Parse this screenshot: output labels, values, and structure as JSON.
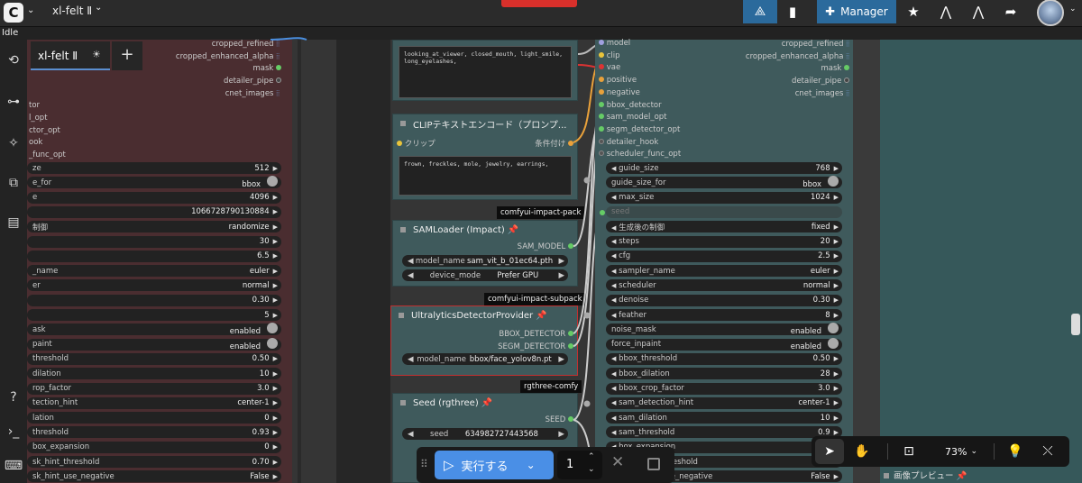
{
  "topbar": {
    "logo": "C",
    "workflow_name": "xl-felt Ⅱ",
    "manager_label": "Manager"
  },
  "status": "Idle",
  "tab": {
    "label": "xl-felt Ⅱ"
  },
  "left_node": {
    "outputs": [
      "cropped_refined",
      "cropped_enhanced_alpha",
      "mask",
      "detailer_pipe",
      "cnet_images"
    ],
    "inputs": [
      "tor",
      "l_opt",
      "ctor_opt",
      "ook",
      "_func_opt"
    ],
    "widgets": [
      {
        "label": "ze",
        "value": "512"
      },
      {
        "label": "e_for",
        "value": "bbox"
      },
      {
        "label": "e",
        "value": "4096"
      },
      {
        "label": "",
        "value": "1066728790130884"
      },
      {
        "label": "制御",
        "value": "randomize"
      },
      {
        "label": "",
        "value": "30"
      },
      {
        "label": "",
        "value": "6.5"
      },
      {
        "label": "_name",
        "value": "euler"
      },
      {
        "label": "er",
        "value": "normal"
      },
      {
        "label": "",
        "value": "0.30"
      },
      {
        "label": "",
        "value": "5"
      },
      {
        "label": "ask",
        "value": "enabled"
      },
      {
        "label": "paint",
        "value": "enabled"
      },
      {
        "label": "threshold",
        "value": "0.50"
      },
      {
        "label": "dilation",
        "value": "10"
      },
      {
        "label": "rop_factor",
        "value": "3.0"
      },
      {
        "label": "tection_hint",
        "value": "center-1"
      },
      {
        "label": "lation",
        "value": "0"
      },
      {
        "label": "threshold",
        "value": "0.93"
      },
      {
        "label": "box_expansion",
        "value": "0"
      },
      {
        "label": "sk_hint_threshold",
        "value": "0.70"
      },
      {
        "label": "sk_hint_use_negative",
        "value": "False"
      }
    ]
  },
  "mid": {
    "prompt1": "looking_at_viewer, closed_mouth, light_smile, long_eyelashes,",
    "clip_title": "CLIPテキストエンコード（プロンプ...",
    "clip_input": "クリップ",
    "clip_output": "条件付け",
    "prompt2": "frown, freckles, mole, jewelry, earrings,",
    "tag1": "comfyui-impact-pack",
    "samloader_title": "SAMLoader (Impact)",
    "sam_output": "SAM_MODEL",
    "model_name_label": "model_name",
    "model_name_value": "sam_vit_b_01ec64.pth",
    "device_mode_label": "device_mode",
    "device_mode_value": "Prefer GPU",
    "tag2": "comfyui-impact-subpack",
    "ultra_title": "UltralyticsDetectorProvider",
    "bbox_out": "BBOX_DETECTOR",
    "segm_out": "SEGM_DETECTOR",
    "ultra_model_label": "model_name",
    "ultra_model_value": "bbox/face_yolov8n.pt",
    "tag3": "rgthree-comfy",
    "seed_title": "Seed (rgthree)",
    "seed_out": "SEED",
    "seed_label": "seed",
    "seed_value": "634982727443568"
  },
  "right_node": {
    "inputs": [
      "model",
      "clip",
      "vae",
      "positive",
      "negative",
      "bbox_detector",
      "sam_model_opt",
      "segm_detector_opt",
      "detailer_hook",
      "scheduler_func_opt"
    ],
    "outputs": [
      "cropped_refined",
      "cropped_enhanced_alpha",
      "mask",
      "detailer_pipe",
      "cnet_images"
    ],
    "widgets": [
      {
        "label": "guide_size",
        "value": "768"
      },
      {
        "label": "guide_size_for",
        "value": "bbox"
      },
      {
        "label": "max_size",
        "value": "1024"
      },
      {
        "label": "seed",
        "value": ""
      },
      {
        "label": "生成後の制御",
        "value": "fixed"
      },
      {
        "label": "steps",
        "value": "20"
      },
      {
        "label": "cfg",
        "value": "2.5"
      },
      {
        "label": "sampler_name",
        "value": "euler"
      },
      {
        "label": "scheduler",
        "value": "normal"
      },
      {
        "label": "denoise",
        "value": "0.30"
      },
      {
        "label": "feather",
        "value": "8"
      },
      {
        "label": "noise_mask",
        "value": "enabled"
      },
      {
        "label": "force_inpaint",
        "value": "enabled"
      },
      {
        "label": "bbox_threshold",
        "value": "0.50"
      },
      {
        "label": "bbox_dilation",
        "value": "28"
      },
      {
        "label": "bbox_crop_factor",
        "value": "3.0"
      },
      {
        "label": "sam_detection_hint",
        "value": "center-1"
      },
      {
        "label": "sam_dilation",
        "value": "10"
      },
      {
        "label": "sam_threshold",
        "value": "0.9"
      },
      {
        "label": "box_expansion",
        "value": ""
      },
      {
        "label": "mask_hint_threshold",
        "value": "0."
      },
      {
        "label": "mask_hint_use_negative",
        "value": "False"
      }
    ]
  },
  "far_right": {
    "preview_title": "画像プレビュー"
  },
  "runbar": {
    "run_label": "実行する",
    "count": "1"
  },
  "zoombar": {
    "zoom": "73%"
  },
  "colors": {
    "accent": "#2b6a9c",
    "node_teal": "#3f5a5c",
    "node_red": "#4a2d30"
  }
}
